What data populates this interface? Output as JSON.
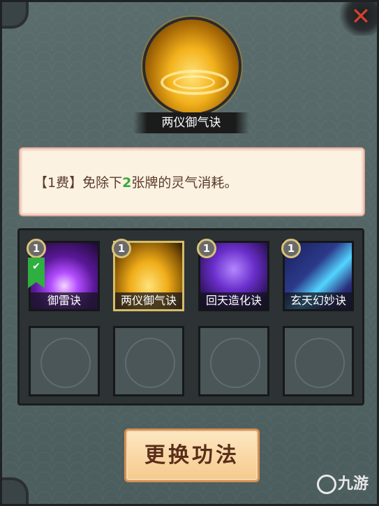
{
  "dialog": {
    "skill_name": "两仪御气诀",
    "description": {
      "prefix": "【1费】免除下",
      "number": "2",
      "suffix": "张牌的灵气消耗。"
    },
    "swap_button_label": "更换功法"
  },
  "cards": [
    {
      "label": "御雷诀",
      "cost": "1",
      "equipped": true,
      "art": "purple-lightning"
    },
    {
      "label": "两仪御气诀",
      "cost": "1",
      "selected": true,
      "art": "golden-yin-yang"
    },
    {
      "label": "回天造化诀",
      "cost": "1",
      "art": "violet-meditating-figure"
    },
    {
      "label": "玄天幻妙诀",
      "cost": "1",
      "art": "cyan-blade-arcs"
    }
  ],
  "empty_slots": 4,
  "watermark": {
    "text": "九游"
  },
  "colors": {
    "highlight_number": "#3aa93a",
    "close": "#d3412f",
    "selected_border": "#d5bd6a",
    "equipped_tag": "#2faf3f"
  }
}
